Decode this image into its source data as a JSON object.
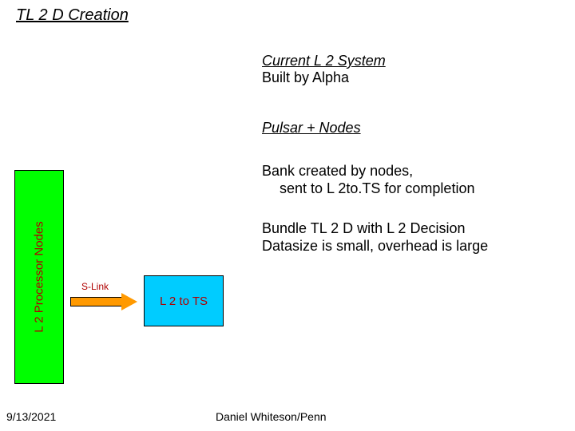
{
  "title": "TL 2 D Creation",
  "current": {
    "heading": "Current L 2 System",
    "sub": "Built by Alpha"
  },
  "pulsar": {
    "heading": "Pulsar + Nodes"
  },
  "bank": {
    "line1": "Bank created by nodes,",
    "line2": "sent to L 2to.TS for completion"
  },
  "bundle": {
    "line1": "Bundle TL 2 D with L 2 Decision",
    "line2": "Datasize is small, overhead is large"
  },
  "diagram": {
    "proc_label": "L 2 Processor Nodes",
    "slink_label": "S-Link",
    "l2ts_label": "L 2 to TS"
  },
  "footer": {
    "date": "9/13/2021",
    "author": "Daniel Whiteson/Penn"
  }
}
